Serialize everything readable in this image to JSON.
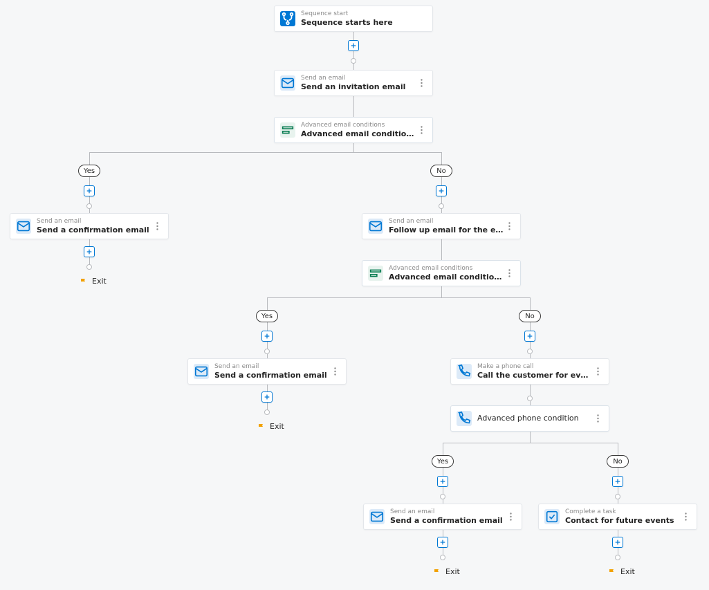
{
  "nodes": {
    "start": {
      "label": "Sequence start",
      "title": "Sequence starts here"
    },
    "invite": {
      "label": "Send an email",
      "title": "Send an invitation email"
    },
    "cond1": {
      "label": "Advanced email conditions",
      "title": "Advanced email conditions"
    },
    "confirm1": {
      "label": "Send an email",
      "title": "Send a confirmation email"
    },
    "followup": {
      "label": "Send an email",
      "title": "Follow up email for the event"
    },
    "cond2": {
      "label": "Advanced email conditions",
      "title": "Advanced email conditions"
    },
    "confirm2": {
      "label": "Send an email",
      "title": "Send a confirmation email"
    },
    "call": {
      "label": "Make a phone call",
      "title": "Call the customer for event"
    },
    "phonecond": {
      "label": "",
      "title": "Advanced phone condition"
    },
    "confirm3": {
      "label": "Send an email",
      "title": "Send a confirmation email"
    },
    "task": {
      "label": "Complete a task",
      "title": "Contact for future events"
    }
  },
  "badges": {
    "yes": "Yes",
    "no": "No"
  },
  "exit_label": "Exit"
}
